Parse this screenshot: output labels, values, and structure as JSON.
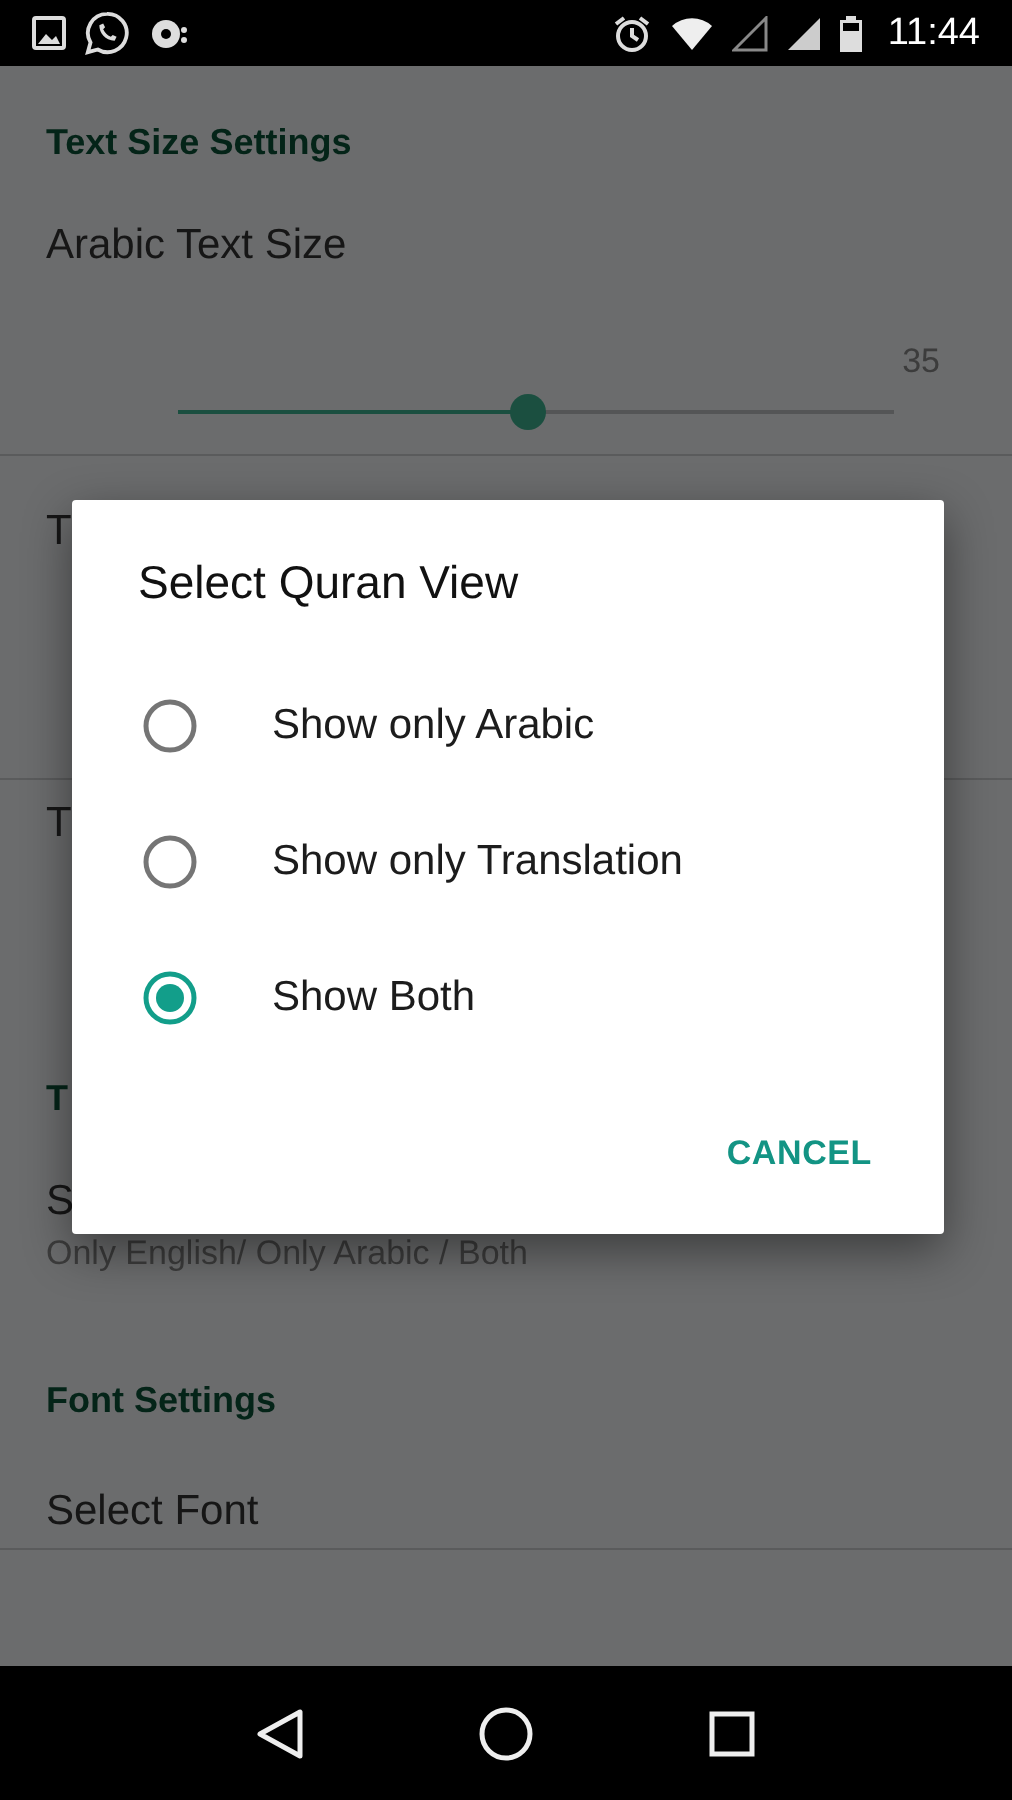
{
  "status_bar": {
    "time": "11:44"
  },
  "settings": [
    {
      "kind": "header",
      "text": "Text Size Settings"
    },
    {
      "kind": "title",
      "text": "Arabic Text Size"
    },
    {
      "kind": "slider",
      "reading": "35",
      "level": 0.49
    },
    {
      "kind": "title",
      "text": "T"
    },
    {
      "kind": "title",
      "text": "T"
    },
    {
      "kind": "header",
      "text": "T"
    },
    {
      "kind": "title",
      "text": "S"
    },
    {
      "kind": "subtitle",
      "text": "Only English/ Only Arabic / Both"
    },
    {
      "kind": "header",
      "text": "Font Settings"
    },
    {
      "kind": "title",
      "text": "Select Font"
    }
  ],
  "dialog": {
    "title": "Select Quran View",
    "options": [
      {
        "label": "Show only Arabic",
        "selected": false
      },
      {
        "label": "Show only Translation",
        "selected": false
      },
      {
        "label": "Show Both",
        "selected": true
      }
    ],
    "button": "CANCEL"
  }
}
